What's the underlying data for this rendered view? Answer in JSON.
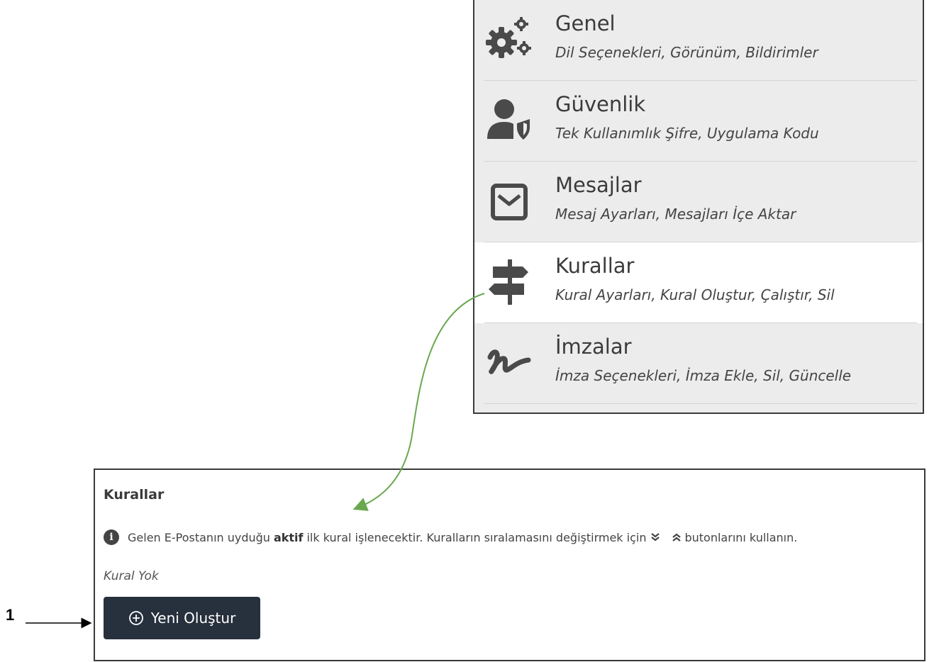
{
  "menu": {
    "items": [
      {
        "title": "Genel",
        "subtitle": "Dil Seçenekleri, Görünüm, Bildirimler",
        "icon": "gears-icon",
        "active": false
      },
      {
        "title": "Güvenlik",
        "subtitle": "Tek Kullanımlık Şifre, Uygulama Kodu",
        "icon": "user-shield-icon",
        "active": false
      },
      {
        "title": "Mesajlar",
        "subtitle": "Mesaj Ayarları, Mesajları İçe Aktar",
        "icon": "envelope-icon",
        "active": false
      },
      {
        "title": "Kurallar",
        "subtitle": "Kural Ayarları, Kural Oluştur, Çalıştır, Sil",
        "icon": "signpost-icon",
        "active": true
      },
      {
        "title": "İmzalar",
        "subtitle": "İmza Seçenekleri, İmza Ekle, Sil, Güncelle",
        "icon": "signature-icon",
        "active": false
      }
    ]
  },
  "rules": {
    "heading": "Kurallar",
    "info_prefix": "Gelen E-Postanın uyduğu",
    "info_bold": "aktif",
    "info_middle": "ilk kural işlenecektir. Kuralların sıralamasını değiştirmek için",
    "info_suffix": "butonlarını kullanın.",
    "empty_text": "Kural Yok",
    "new_button_label": "Yeni Oluştur"
  },
  "annotation": {
    "number": "1"
  },
  "colors": {
    "menu_bg": "#ececec",
    "active_bg": "#ffffff",
    "button_bg": "#27303d",
    "arrow_green": "#6aa84f",
    "icon_gray": "#4a4a4a"
  }
}
